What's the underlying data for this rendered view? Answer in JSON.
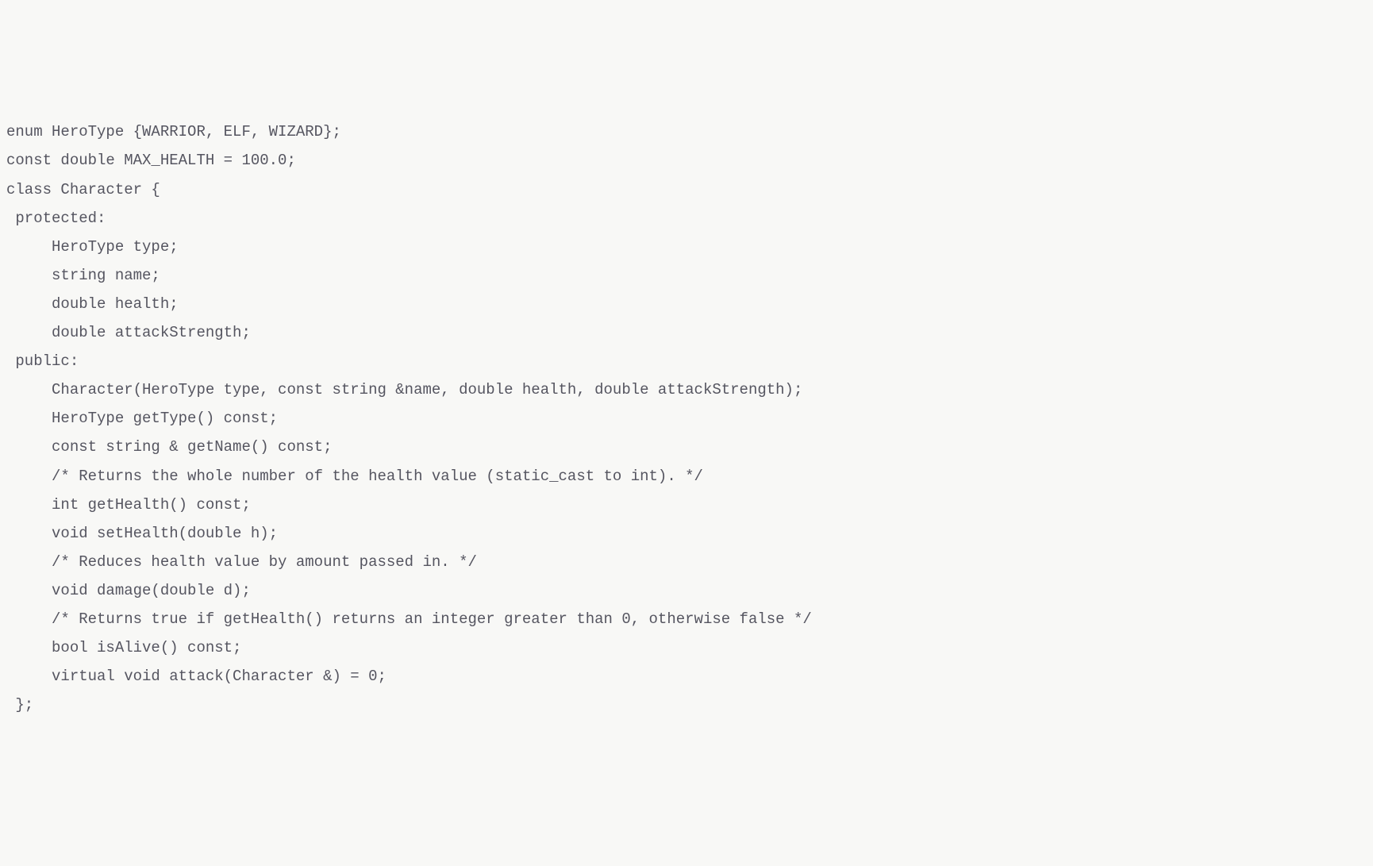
{
  "code": {
    "lines": [
      "enum HeroType {WARRIOR, ELF, WIZARD};",
      "",
      "const double MAX_HEALTH = 100.0;",
      "",
      "class Character {",
      " protected:",
      "     HeroType type;",
      "     string name;",
      "     double health;",
      "     double attackStrength;",
      "",
      " public:",
      "     Character(HeroType type, const string &name, double health, double attackStrength);",
      "     HeroType getType() const;",
      "     const string & getName() const;",
      "     /* Returns the whole number of the health value (static_cast to int). */",
      "     int getHealth() const;",
      "     void setHealth(double h);",
      "     /* Reduces health value by amount passed in. */",
      "     void damage(double d);",
      "     /* Returns true if getHealth() returns an integer greater than 0, otherwise false */",
      "     bool isAlive() const;",
      "     virtual void attack(Character &) = 0;",
      " };"
    ]
  }
}
